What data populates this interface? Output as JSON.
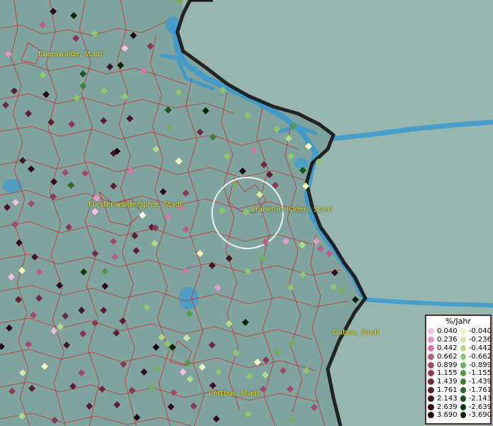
{
  "map": {
    "labels": {
      "eberswalde": "Eberswalde, Stadt",
      "fuerstenwalde": "Fürstenwalde/Spree, Stadt",
      "frankfurt": "Frankfurt (Oder), Stadt",
      "guben": "Guben, Stadt",
      "cottbus": "Cottbus, Stadt"
    },
    "colors": {
      "terrain": "#7fa39e",
      "border_red": "#d42424",
      "water": "#3a9ad0",
      "national_border": "#1a1414",
      "highlight_circle": "#ffffff"
    }
  },
  "legend": {
    "title": "%/Jahr",
    "positive": [
      {
        "value": "0.040",
        "color": "#f2bfe3"
      },
      {
        "value": "0.236",
        "color": "#e39bc5"
      },
      {
        "value": "0.442",
        "color": "#cf7aa4"
      },
      {
        "value": "0.662",
        "color": "#b85f84"
      },
      {
        "value": "0.899",
        "color": "#a04b6a"
      },
      {
        "value": "1.155",
        "color": "#883a55"
      },
      {
        "value": "1.439",
        "color": "#702b43"
      },
      {
        "value": "1.761",
        "color": "#5a1f33"
      },
      {
        "value": "2.143",
        "color": "#441525"
      },
      {
        "value": "2.639",
        "color": "#300c18"
      },
      {
        "value": "3.690",
        "color": "#1c050c"
      }
    ],
    "negative": [
      {
        "value": "-0.040",
        "color": "#f0f5b8"
      },
      {
        "value": "-0.236",
        "color": "#d3e8a2"
      },
      {
        "value": "-0.442",
        "color": "#b4d88a"
      },
      {
        "value": "-0.662",
        "color": "#93c571"
      },
      {
        "value": "-0.899",
        "color": "#74b05b"
      },
      {
        "value": "-1.155",
        "color": "#569a47"
      },
      {
        "value": "-1.439",
        "color": "#3e8236"
      },
      {
        "value": "-1.761",
        "color": "#2b6a28"
      },
      {
        "value": "-2.143",
        "color": "#1c521b"
      },
      {
        "value": "-2.639",
        "color": "#103b10"
      },
      {
        "value": "-3.690",
        "color": "#062406"
      }
    ]
  }
}
